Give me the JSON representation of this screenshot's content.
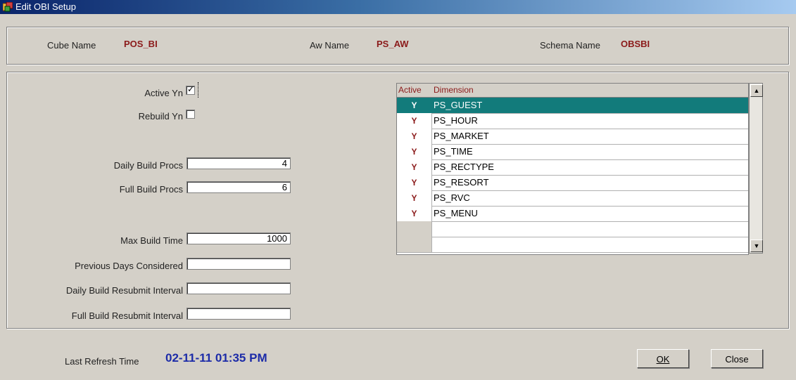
{
  "window": {
    "title": "Edit OBI Setup",
    "icon": "app-icon"
  },
  "header": {
    "cube_label": "Cube Name",
    "cube_value": "POS_BI",
    "aw_label": "Aw Name",
    "aw_value": "PS_AW",
    "schema_label": "Schema Name",
    "schema_value": "OBSBI"
  },
  "form": {
    "active_label": "Active Yn",
    "active_checked": true,
    "rebuild_label": "Rebuild Yn",
    "rebuild_checked": false,
    "daily_procs_label": "Daily Build Procs",
    "daily_procs_value": "4",
    "full_procs_label": "Full Build Procs",
    "full_procs_value": "6",
    "max_time_label": "Max Build Time",
    "max_time_value": "1000",
    "prev_days_label": "Previous Days Considered",
    "prev_days_value": "",
    "daily_resubmit_label": "Daily Build Resubmit Interval",
    "daily_resubmit_value": "",
    "full_resubmit_label": "Full Build Resubmit Interval",
    "full_resubmit_value": ""
  },
  "grid": {
    "headers": {
      "active": "Active",
      "dimension": "Dimension"
    },
    "rows": [
      {
        "active": "Y",
        "dimension": "PS_GUEST"
      },
      {
        "active": "Y",
        "dimension": "PS_HOUR"
      },
      {
        "active": "Y",
        "dimension": "PS_MARKET"
      },
      {
        "active": "Y",
        "dimension": "PS_TIME"
      },
      {
        "active": "Y",
        "dimension": "PS_RECTYPE"
      },
      {
        "active": "Y",
        "dimension": "PS_RESORT"
      },
      {
        "active": "Y",
        "dimension": "PS_RVC"
      },
      {
        "active": "Y",
        "dimension": "PS_MENU"
      },
      {
        "active": "",
        "dimension": ""
      },
      {
        "active": "",
        "dimension": ""
      }
    ],
    "selected_index": 0
  },
  "footer": {
    "refresh_label": "Last Refresh Time",
    "refresh_value": "02-11-11 01:35 PM",
    "ok_label": "OK",
    "close_label": "Close"
  },
  "colors": {
    "label_value": "#8b1a1a",
    "selection": "#127b7b",
    "refresh_value": "#1c2ba8"
  }
}
